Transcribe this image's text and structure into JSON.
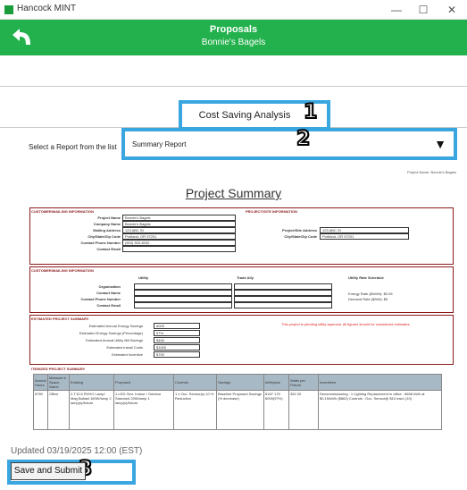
{
  "window": {
    "title": "Hancock MINT",
    "minimize": "—",
    "maximize": "☐",
    "close": "✕"
  },
  "header": {
    "title": "Proposals",
    "subtitle": "Bonnie's Bagels"
  },
  "analysis": {
    "title": "Cost Saving Analysis"
  },
  "report_select": {
    "label": "Select a Report from the list",
    "value": "Summary Report",
    "arrow": "▼"
  },
  "markers": [
    "1",
    "2",
    "3"
  ],
  "document": {
    "project_name_line": "Project Name: Bonnie's Bagels",
    "title": "Project Summary",
    "customer": {
      "heading": "CUSTOMER/MAILING INFORMATION",
      "fields": [
        {
          "label": "Project Name",
          "value": "Bonnie's Bagels"
        },
        {
          "label": "Company Name",
          "value": "Bonnie's Bagels"
        },
        {
          "label": "Mailing Address",
          "value": "123 ABC St"
        },
        {
          "label": "City/State/Zip Code",
          "value": "Portland, OR 97201"
        },
        {
          "label": "Contact Phone Number",
          "value": "(503) 503-5032"
        },
        {
          "label": "Contact Email",
          "value": ""
        }
      ]
    },
    "site": {
      "heading": "PROJECT/SITE INFORMATION",
      "fields": [
        {
          "label": "Project/Site Address",
          "value": "123 ABC St"
        },
        {
          "label": "City/State/Zip Code",
          "value": "Portland, OR 97201"
        }
      ]
    },
    "contacts": {
      "heading": "CUSTOMER/MAILING INFORMATION",
      "col_utility": "Utility",
      "col_trade": "Trade Ally",
      "col_rate": "Utility Rate Schedule",
      "rows": [
        "Organization",
        "Contact Name",
        "Contact Phone Number",
        "Contact Email"
      ],
      "energy_rate": "Energy Rate ($/kWh): $0.06",
      "demand_rate": "Demand Rate ($/kW): $5"
    },
    "estimated": {
      "heading": "ESTIMATED PROJECT SUMMARY",
      "fields": [
        {
          "label": "Estimated Annual Energy Savings",
          "value": "6009"
        },
        {
          "label": "Estimated Energy Savings (Percentage)",
          "value": "97%"
        },
        {
          "label": "Estimated Annual Utility Bill Savings",
          "value": "$450"
        },
        {
          "label": "Estimated Install Costs",
          "value": "$1000"
        },
        {
          "label": "Estimated Incentive",
          "value": "$700"
        }
      ],
      "note": "This project is pending utility approval. All figures should be considered estimates."
    },
    "itemized": {
      "heading": "ITEMIZED PROJECT SUMMARY",
      "headers": [
        "Annual Hours",
        "Measure # Space Name",
        "Existing",
        "Proposed",
        "Controls",
        "Savings",
        "kWh/year",
        "Watts per Fixture",
        "Incentives"
      ],
      "row": [
        "8760",
        "Office",
        "2-T10 6 RVHO Lamp/ Mag Ballast 160W/lamp 2 lamp(s)/fixture",
        "1-LED Gen. Indoor / Outdoor Standard 20W/lamp 1 lamp(s)/fixture",
        "1 x Occ. Sensor(s) 10 % Reduction",
        "Baseline Proposed Savings (% decrease)",
        "6167 175 6009(97%)",
        "352 20",
        "Decommissioning : 1 Lighting Replacement in office : 6658 kWh at $0.15/kWh ($863) Controls : Occ. Sensor@ $10 each (10)"
      ]
    }
  },
  "footer": {
    "updated": "Updated 03/19/2025 12:00 (EST)",
    "save_label": "Save and Submit"
  },
  "colors": {
    "header_green": "#22b14c",
    "callout_blue": "#3aa6e0",
    "section_red": "#8b1a1a"
  }
}
